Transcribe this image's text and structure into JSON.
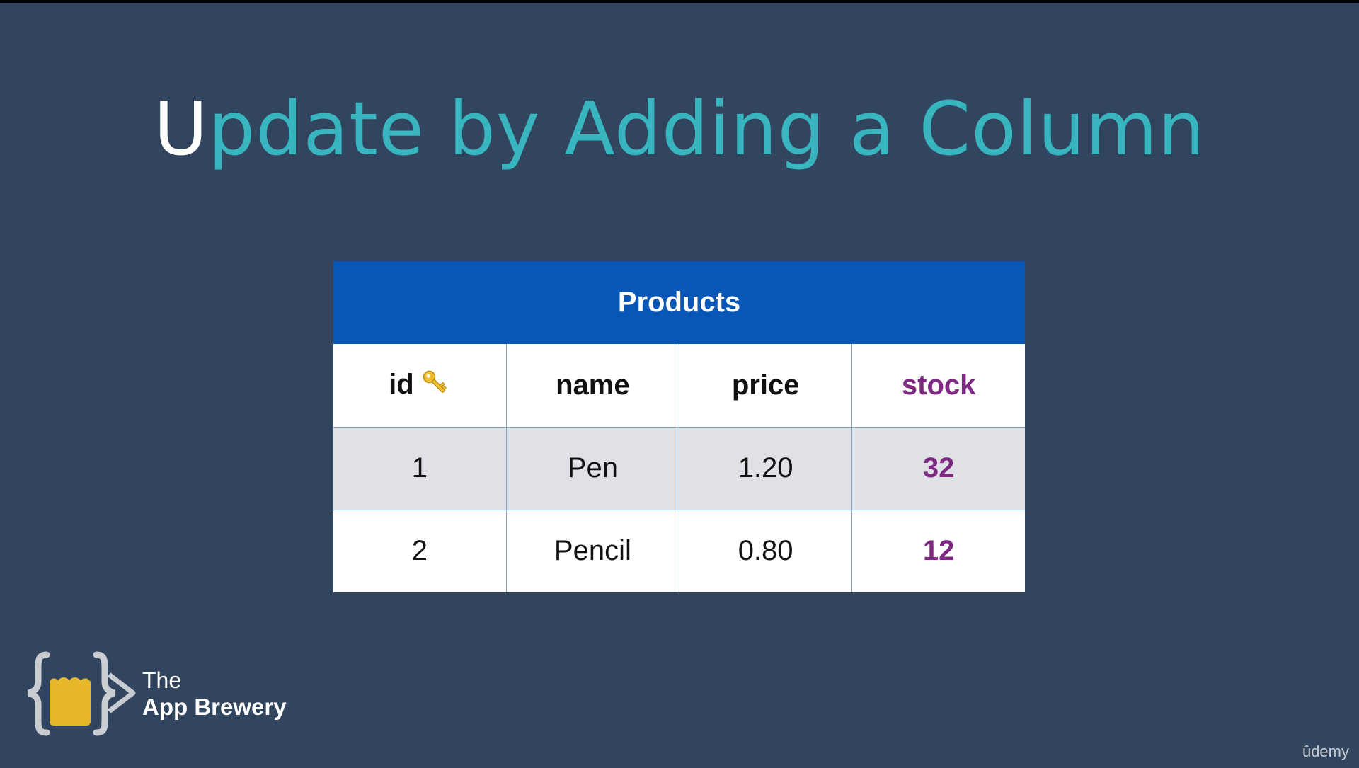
{
  "slide": {
    "title_first_letter": "U",
    "title_rest": "pdate by Adding a Column"
  },
  "table": {
    "title": "Products",
    "columns": [
      {
        "label": "id",
        "icon": "key-icon"
      },
      {
        "label": "name"
      },
      {
        "label": "price"
      },
      {
        "label": "stock",
        "highlight": true
      }
    ],
    "rows": [
      {
        "id": "1",
        "name": "Pen",
        "price": "1.20",
        "stock": "32"
      },
      {
        "id": "2",
        "name": "Pencil",
        "price": "0.80",
        "stock": "12"
      }
    ]
  },
  "branding": {
    "logo_line1": "The",
    "logo_line2": "App Brewery",
    "watermark": "ûdemy"
  },
  "colors": {
    "background": "#31455f",
    "title_accent": "#38b5bf",
    "table_header": "#0857b6",
    "highlight": "#7e2a82",
    "odd_row": "#e0e1e6",
    "logo_yellow": "#e6b72a"
  }
}
